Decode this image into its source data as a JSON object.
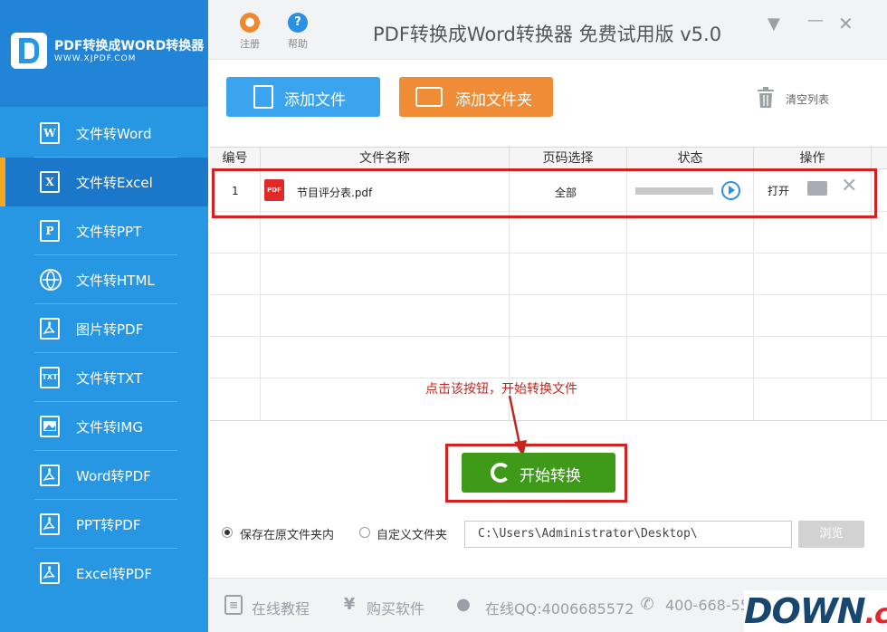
{
  "sidebar": {
    "logo_title": "PDF转换成WORD转换器",
    "logo_url": "WWW.XJPDF.COM",
    "items": [
      {
        "label": "文件转Word",
        "icon": "word-file-icon",
        "glyph": "W"
      },
      {
        "label": "文件转Excel",
        "icon": "excel-file-icon",
        "glyph": "X",
        "active": true
      },
      {
        "label": "文件转PPT",
        "icon": "ppt-file-icon",
        "glyph": "P"
      },
      {
        "label": "文件转HTML",
        "icon": "globe-icon",
        "glyph": ""
      },
      {
        "label": "图片转PDF",
        "icon": "pdf-file-icon",
        "glyph": ""
      },
      {
        "label": "文件转TXT",
        "icon": "txt-file-icon",
        "glyph": "TXT"
      },
      {
        "label": "文件转IMG",
        "icon": "image-file-icon",
        "glyph": ""
      },
      {
        "label": "Word转PDF",
        "icon": "pdf-file-icon",
        "glyph": ""
      },
      {
        "label": "PPT转PDF",
        "icon": "pdf-file-icon",
        "glyph": ""
      },
      {
        "label": "Excel转PDF",
        "icon": "pdf-file-icon",
        "glyph": ""
      }
    ]
  },
  "topbar": {
    "register_label": "注册",
    "help_label": "帮助",
    "title": "PDF转换成Word转换器 免费试用版 v5.0"
  },
  "toolbar": {
    "add_file_label": "添加文件",
    "add_folder_label": "添加文件夹",
    "clear_list_label": "清空列表"
  },
  "table": {
    "columns": [
      "编号",
      "文件名称",
      "页码选择",
      "状态",
      "操作"
    ],
    "rows": [
      {
        "index": "1",
        "file_name": "节目评分表.pdf",
        "page_range": "全部",
        "progress": 0,
        "action_label": "打开"
      }
    ]
  },
  "annotation": "点击该按钮，开始转换文件",
  "start": {
    "label": "开始转换"
  },
  "save_options": {
    "original_folder_label": "保存在原文件夹内",
    "custom_folder_label": "自定义文件夹",
    "path_value": "C:\\Users\\Administrator\\Desktop\\",
    "browse_label": "浏览"
  },
  "footer": {
    "tutorial_label": "在线教程",
    "buy_label": "购买软件",
    "qq_label": "在线QQ:4006685572",
    "phone_label": "400-668-55"
  },
  "watermark": {
    "main": "DOWN",
    "suffix": ".cc"
  },
  "colors": {
    "sidebar_bg": "#2796e3",
    "active_accent": "#f5a623",
    "add_file_button": "#3aa5ee",
    "add_folder_button": "#f08b36",
    "start_button": "#3f9a19",
    "highlight_red": "#d32020"
  }
}
